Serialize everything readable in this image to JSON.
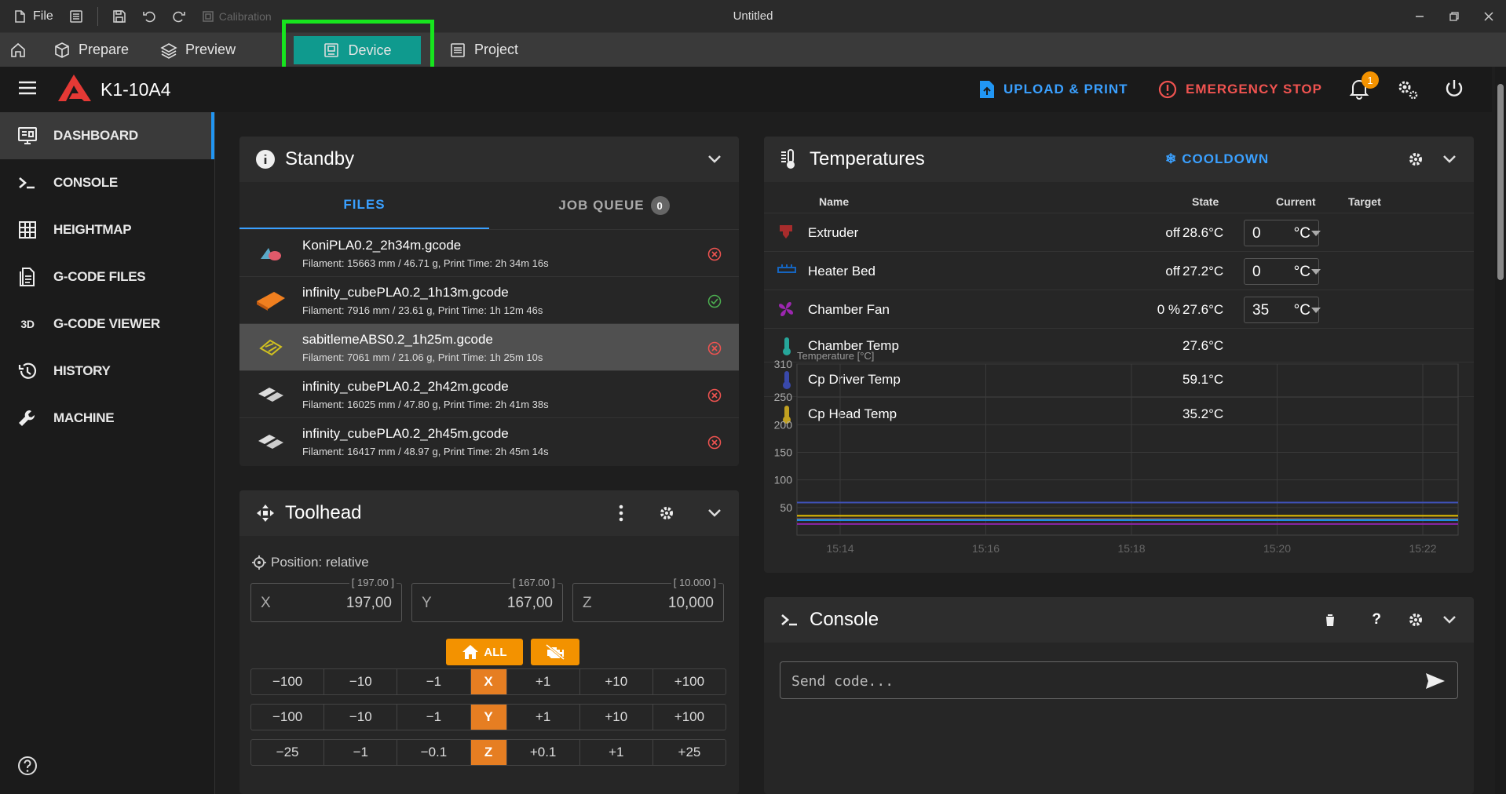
{
  "titlebar": {
    "file_label": "File",
    "calibration_label": "Calibration",
    "window_title": "Untitled"
  },
  "tabs": {
    "prepare": "Prepare",
    "preview": "Preview",
    "device": "Device",
    "project": "Project"
  },
  "header": {
    "printer_name": "K1-10A4",
    "upload_print": "UPLOAD & PRINT",
    "emergency_stop": "EMERGENCY STOP",
    "notification_count": "1"
  },
  "sidebar": {
    "items": [
      {
        "label": "DASHBOARD",
        "icon": "monitor-dashboard-icon"
      },
      {
        "label": "CONSOLE",
        "icon": "console-icon"
      },
      {
        "label": "HEIGHTMAP",
        "icon": "grid-icon"
      },
      {
        "label": "G-CODE FILES",
        "icon": "file-document-icon"
      },
      {
        "label": "G-CODE VIEWER",
        "icon": "3d-icon"
      },
      {
        "label": "HISTORY",
        "icon": "history-icon"
      },
      {
        "label": "MACHINE",
        "icon": "wrench-icon"
      }
    ],
    "viewer_icon_text": "3D"
  },
  "standby": {
    "title": "Standby",
    "tab_files": "FILES",
    "tab_queue": "JOB QUEUE",
    "queue_count": "0",
    "files": [
      {
        "name": "KoniPLA0.2_2h34m.gcode",
        "meta": "Filament: 15663 mm / 46.71 g, Print Time: 2h 34m 16s",
        "status": "error"
      },
      {
        "name": "infinity_cubePLA0.2_1h13m.gcode",
        "meta": "Filament: 7916 mm / 23.61 g, Print Time: 1h 12m 46s",
        "status": "ok"
      },
      {
        "name": "sabitlemeABS0.2_1h25m.gcode",
        "meta": "Filament: 7061 mm / 21.06 g, Print Time: 1h 25m 10s",
        "status": "error"
      },
      {
        "name": "infinity_cubePLA0.2_2h42m.gcode",
        "meta": "Filament: 16025 mm / 47.80 g, Print Time: 2h 41m 38s",
        "status": "error"
      },
      {
        "name": "infinity_cubePLA0.2_2h45m.gcode",
        "meta": "Filament: 16417 mm / 48.97 g, Print Time: 2h 45m 14s",
        "status": "error"
      }
    ]
  },
  "toolhead": {
    "title": "Toolhead",
    "position_label": "Position: relative",
    "x": {
      "label": "X",
      "value": "197,00",
      "top": "[ 197.00 ]"
    },
    "y": {
      "label": "Y",
      "value": "167,00",
      "top": "[ 167.00 ]"
    },
    "z": {
      "label": "Z",
      "value": "10,000",
      "top": "[ 10.000 ]"
    },
    "home_all": "ALL",
    "jog_rows": [
      {
        "axis": "X",
        "minus": [
          "−100",
          "−10",
          "−1"
        ],
        "plus": [
          "+1",
          "+10",
          "+100"
        ]
      },
      {
        "axis": "Y",
        "minus": [
          "−100",
          "−10",
          "−1"
        ],
        "plus": [
          "+1",
          "+10",
          "+100"
        ]
      },
      {
        "axis": "Z",
        "minus": [
          "−25",
          "−1",
          "−0.1"
        ],
        "plus": [
          "+0.1",
          "+1",
          "+25"
        ]
      }
    ]
  },
  "temperatures": {
    "title": "Temperatures",
    "cooldown": "COOLDOWN",
    "columns": {
      "name": "Name",
      "state": "State",
      "current": "Current",
      "target": "Target"
    },
    "rows": [
      {
        "name": "Extruder",
        "state": "off",
        "current": "28.6°C",
        "target": "0",
        "unit": "°C",
        "color": "#d32f2f"
      },
      {
        "name": "Heater Bed",
        "state": "off",
        "current": "27.2°C",
        "target": "0",
        "unit": "°C",
        "color": "#1565c0"
      },
      {
        "name": "Chamber Fan",
        "state": "0 %",
        "current": "27.6°C",
        "target": "35",
        "unit": "°C",
        "color": "#9c27b0"
      },
      {
        "name": "Chamber Temp",
        "state": "",
        "current": "27.6°C",
        "target": "",
        "unit": "",
        "color": "#26a69a"
      },
      {
        "name": "Cp Driver Temp",
        "state": "",
        "current": "59.1°C",
        "target": "",
        "unit": "",
        "color": "#3949ab"
      },
      {
        "name": "Cp Head Temp",
        "state": "",
        "current": "35.2°C",
        "target": "",
        "unit": "",
        "color": "#c0a020"
      }
    ]
  },
  "chart_data": {
    "type": "line",
    "ylabel": "Temperature [°C]",
    "ylim": [
      0,
      310
    ],
    "yticks": [
      50,
      100,
      150,
      200,
      250,
      310
    ],
    "x_ticks": [
      "15:14",
      "15:16",
      "15:18",
      "15:20",
      "15:22"
    ],
    "series": [
      {
        "color": "#3f51b5",
        "values": [
          59,
          59,
          59,
          59,
          59
        ]
      },
      {
        "color": "#e6c000",
        "values": [
          35,
          35,
          35,
          35,
          35
        ]
      },
      {
        "color": "#e53935",
        "values": [
          29,
          29,
          29,
          29,
          29
        ]
      },
      {
        "color": "#26a69a",
        "values": [
          28,
          28,
          28,
          28,
          28
        ]
      },
      {
        "color": "#1e88e5",
        "values": [
          27,
          27,
          27,
          27,
          27
        ]
      },
      {
        "color": "#8e24aa",
        "values": [
          20,
          20,
          20,
          20,
          20
        ]
      }
    ],
    "grid": true
  },
  "console": {
    "title": "Console",
    "placeholder": "Send code..."
  },
  "colors": {
    "accent": "#0f9a8e",
    "blue": "#3aa0ff",
    "danger": "#ef5350",
    "orange": "#f39200"
  }
}
